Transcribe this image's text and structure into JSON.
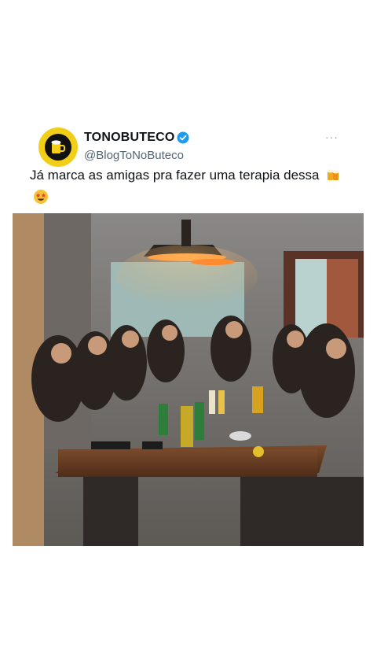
{
  "post": {
    "display_name": "TONOBUTECO",
    "handle": "@BlogToNoButeco",
    "text": "Já marca as amigas pra fazer uma terapia dessa",
    "more": "···"
  },
  "icons": {
    "avatar": "beer-mug-logo-icon",
    "verified": "verified-badge-icon",
    "emoji_1": "beer-mugs-emoji-icon",
    "emoji_2": "star-struck-emoji-icon"
  },
  "colors": {
    "avatar_ring": "#f2cf16",
    "verified": "#1d9bf0",
    "handle": "#536471"
  }
}
